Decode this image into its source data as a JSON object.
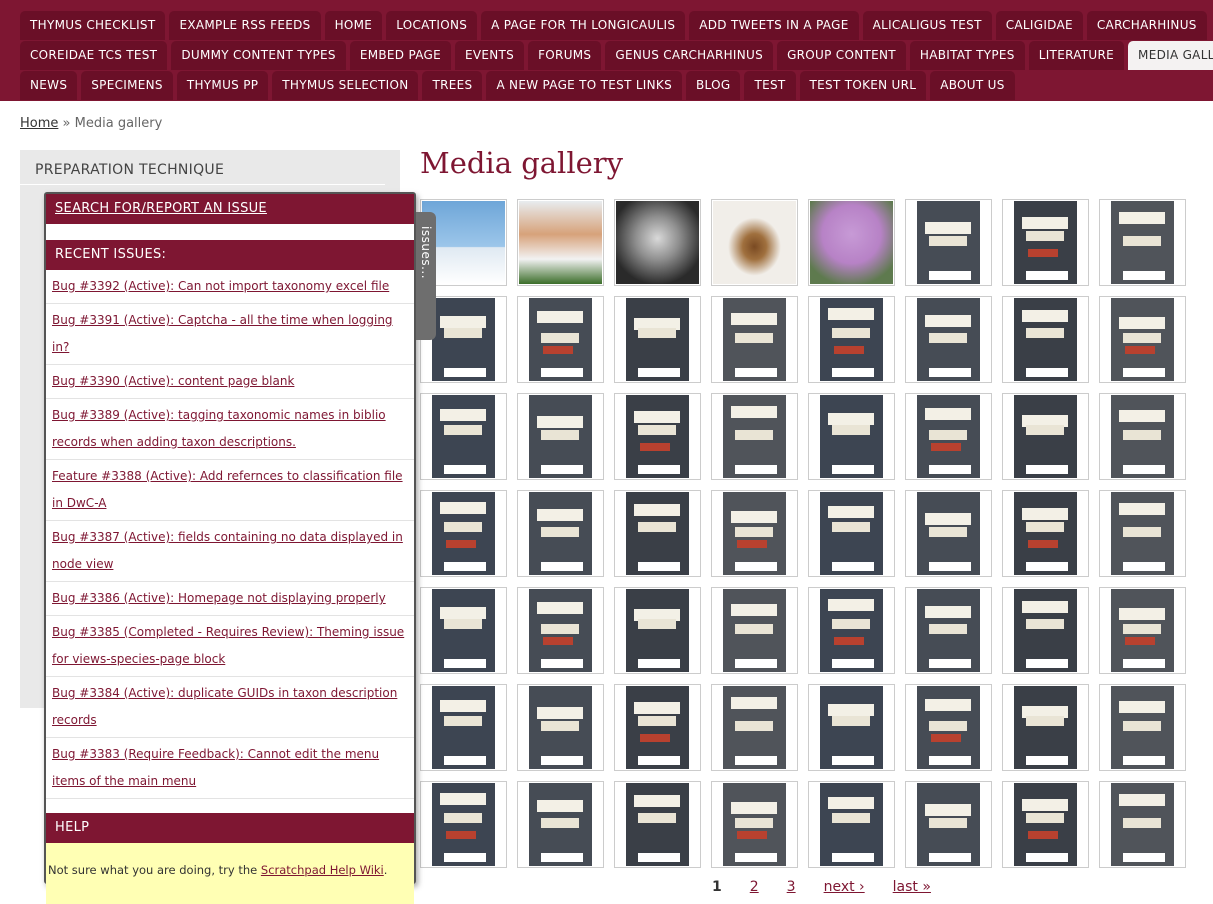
{
  "nav": {
    "row1": [
      "THYMUS CHECKLIST",
      "EXAMPLE RSS FEEDS",
      "HOME",
      "LOCATIONS",
      "A PAGE FOR TH LONGICAULIS",
      "ADD TWEETS IN A PAGE",
      "ALICALIGUS TEST",
      "CALIGIDAE",
      "CARCHARHINUS"
    ],
    "row2": [
      "COREIDAE TCS TEST",
      "DUMMY CONTENT TYPES",
      "EMBED PAGE",
      "EVENTS",
      "FORUMS",
      "GENUS CARCHARHINUS",
      "GROUP CONTENT",
      "HABITAT TYPES",
      "LITERATURE",
      "MEDIA GALLERY"
    ],
    "row3": [
      "NEWS",
      "SPECIMENS",
      "THYMUS PP",
      "THYMUS SELECTION",
      "TREES",
      "A NEW PAGE TO TEST LINKS",
      "BLOG",
      "TEST",
      "TEST TOKEN URL",
      "ABOUT US"
    ]
  },
  "breadcrumb": {
    "home": "Home",
    "sep": "»",
    "current": "Media gallery"
  },
  "sidebar": {
    "heading": "PREPARATION TECHNIQUE"
  },
  "issues": {
    "tab_label": "issues...",
    "search_label": "SEARCH FOR/REPORT AN ISSUE",
    "recent_label": "RECENT ISSUES:",
    "items": [
      "Bug #3392 (Active): Can not import taxonomy excel file",
      "Bug #3391 (Active): Captcha - all the time when logging in?",
      "Bug #3390 (Active): content page blank",
      "Bug #3389 (Active): tagging taxonomic names in biblio records when adding taxon descriptions.",
      "Feature #3388 (Active): Add refernces to classification file in DwC-A",
      "Bug #3387 (Active): fields containing no data displayed in node view",
      "Bug #3386 (Active): Homepage not displaying properly",
      "Bug #3385 (Completed - Requires Review): Theming issue for views-species-page block",
      "Bug #3384 (Active): duplicate GUIDs in taxon description records",
      "Bug #3383 (Require Feedback): Cannot edit the menu items of the main menu"
    ],
    "help_label": "HELP",
    "help_text": "Not sure what you are doing, try the ",
    "help_link": "Scratchpad Help Wiki",
    "help_end": "."
  },
  "main": {
    "title": "Media gallery",
    "thumbs": [
      "penguins",
      "man-portrait",
      "einstein-portrait",
      "insect-specimen",
      "pink-flowers",
      "specimen-100015",
      "specimen-100016",
      "specimen-100017",
      "specimen-100018",
      "specimen-100019",
      "specimen-100020",
      "specimen-100021",
      "specimen-100022",
      "specimen-100023",
      "specimen-100024",
      "specimen-100025",
      "specimen-100026",
      "specimen-100027",
      "specimen-100028",
      "specimen-100029",
      "specimen-100030",
      "specimen-100031",
      "specimen-100032",
      "specimen-100033",
      "specimen-100034",
      "specimen-100035",
      "specimen-100036",
      "specimen-100037",
      "specimen-100037b",
      "specimen-100038",
      "specimen-100039",
      "specimen-100040",
      "specimen-100041",
      "specimen-100042",
      "specimen-100043",
      "specimen-100044",
      "specimen-100045",
      "specimen-100054",
      "specimen-100055",
      "specimen-100056",
      "specimen-100057",
      "specimen-100058",
      "specimen-100059",
      "specimen-100060",
      "specimen-100061",
      "specimen-100062",
      "specimen-100063",
      "specimen-100064",
      "specimen-100065",
      "specimen-100066",
      "specimen-100067",
      "specimen-100068",
      "specimen-100069",
      "specimen-100070",
      "specimen-100071",
      "specimen-100072"
    ],
    "pager": [
      "1",
      "2",
      "3",
      "next ›",
      "last »"
    ]
  }
}
